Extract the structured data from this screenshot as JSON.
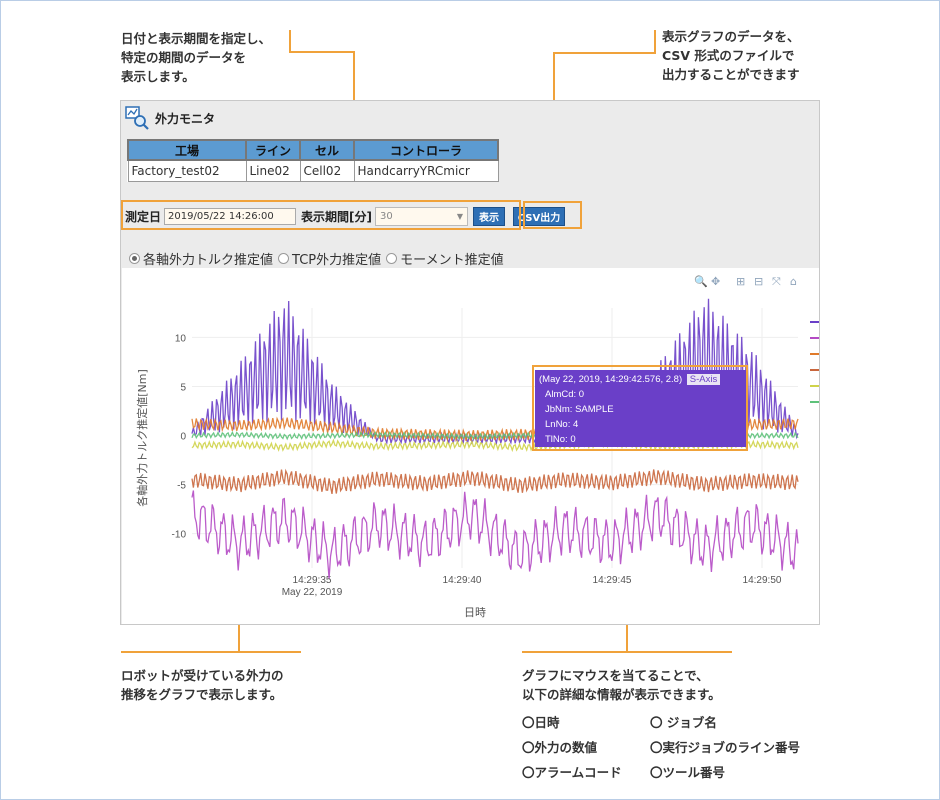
{
  "callouts": {
    "date_period": "日付と表示期間を指定し、\n特定の期間のデータを\n表示します。",
    "csv": "表示グラフのデータを、\nCSV 形式のファイルで\n出力することができます",
    "graph": "ロボットが受けている外力の\n推移をグラフで表示します。",
    "mouse": "グラフにマウスを当てることで、\n以下の詳細な情報が表示できます。",
    "info_items": [
      "〇日時",
      "〇 ジョブ名",
      "〇外力の数値",
      "〇実行ジョブのライン番号",
      "〇アラームコード",
      "〇ツール番号"
    ]
  },
  "window": {
    "title": "外力モニタ"
  },
  "info_table": {
    "headers": [
      "工場",
      "ライン",
      "セル",
      "コントローラ"
    ],
    "values": [
      "Factory_test02",
      "Line02",
      "Cell02",
      "HandcarryYRCmicr"
    ]
  },
  "controls": {
    "date_label": "測定日",
    "date_value": "2019/05/22 14:26:00",
    "period_label": "表示期間[分]",
    "period_value": "30",
    "show_button": "表示",
    "csv_button": "CSV出力"
  },
  "radios": [
    {
      "label": "各軸外力トルク推定値",
      "selected": true
    },
    {
      "label": "TCP外力推定値",
      "selected": false
    },
    {
      "label": "モーメント推定値",
      "selected": false
    }
  ],
  "toolbar_icons": [
    "zoom-icon",
    "pan-icon",
    "zoom-in-icon",
    "zoom-out-icon",
    "autoscale-icon",
    "home-icon"
  ],
  "tooltip": {
    "header": "(May 22, 2019, 14:29:42.576, 2.8)",
    "axis": "S-Axis",
    "lines": [
      "AlmCd: 0",
      "JbNm: SAMPLE",
      "LnNo: 4",
      "TlNo: 0"
    ]
  },
  "chart_data": {
    "type": "line",
    "ylabel": "各軸外力トルク推定値[Nm]",
    "xlabel": "日時",
    "x_ticks": [
      "14:29:35",
      "14:29:40",
      "14:29:45",
      "14:29:50"
    ],
    "x_tick_sublabel": "May 22, 2019",
    "y_ticks": [
      10,
      5,
      0,
      -5,
      -10
    ],
    "x_range": [
      "14:29:31",
      "14:29:51.2"
    ],
    "ylim": [
      -13.5,
      13
    ],
    "series": [
      {
        "color": "#6a3fc8",
        "values": [
          0.2,
          4,
          8,
          3,
          -0.3,
          -0.3,
          -0.3,
          -0.3,
          -0.3,
          0.5,
          4,
          8,
          5,
          0.2
        ]
      },
      {
        "color": "#b44ac4",
        "values": [
          -8,
          -11,
          -8.5,
          -12,
          -9,
          -11,
          -8,
          -12,
          -9.5,
          -11,
          -8,
          -11.5,
          -9,
          -12
        ]
      },
      {
        "color": "#e07a2a",
        "values": [
          1.2,
          1,
          1.3,
          0.8,
          0.2,
          0.1,
          0,
          0.1,
          0.2,
          0.8,
          1.5,
          1.3,
          1.1,
          1.2
        ]
      },
      {
        "color": "#c9663c",
        "values": [
          -4.5,
          -5,
          -4.2,
          -5.2,
          -4.4,
          -4.9,
          -4.3,
          -5.1,
          -4.5,
          -4.8,
          -4.2,
          -5,
          -4.6,
          -4.8
        ]
      },
      {
        "color": "#cfd34a",
        "values": [
          -1,
          -0.9,
          -1.2,
          -0.8,
          -1.1,
          -1,
          -0.9,
          -1.2,
          -1,
          -0.8,
          -1.1,
          -1,
          -0.9,
          -1
        ]
      },
      {
        "color": "#5ec27a",
        "values": [
          0,
          0.1,
          -0.1,
          0,
          0.1,
          0,
          -0.1,
          0,
          0.1,
          0,
          -0.1,
          0.1,
          0,
          0
        ]
      }
    ]
  }
}
